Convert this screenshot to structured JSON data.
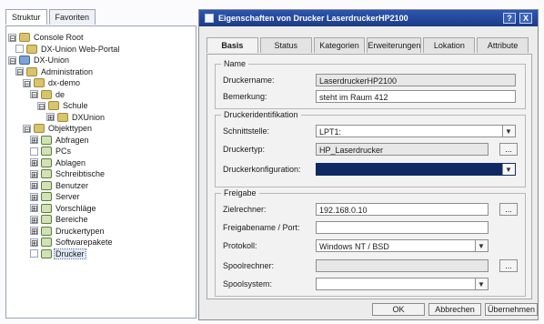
{
  "left": {
    "tabs": [
      "Struktur",
      "Favoriten"
    ],
    "tree": [
      {
        "label": "Console Root",
        "expander": "⊟",
        "icon": "folder-icon"
      },
      {
        "label": "DX-Union Web-Portal",
        "expander": "",
        "icon": "folder-icon"
      },
      {
        "label": "DX-Union",
        "expander": "⊟",
        "icon": "root-icon"
      },
      {
        "label": "Administration",
        "expander": "⊟",
        "icon": "folder-icon"
      },
      {
        "label": "dx-demo",
        "expander": "⊟",
        "icon": "folder-icon"
      },
      {
        "label": "de",
        "expander": "⊟",
        "icon": "folder-icon"
      },
      {
        "label": "Schule",
        "expander": "⊟",
        "icon": "folder-icon"
      },
      {
        "label": "DXUnion",
        "expander": "⊞",
        "icon": "folder-icon"
      },
      {
        "label": "Objekttypen",
        "expander": "⊟",
        "icon": "folder-icon"
      },
      {
        "label": "Abfragen",
        "expander": "⊞",
        "icon": "object-icon"
      },
      {
        "label": "PCs",
        "expander": "",
        "icon": "object-icon"
      },
      {
        "label": "Ablagen",
        "expander": "⊞",
        "icon": "object-icon"
      },
      {
        "label": "Schreibtische",
        "expander": "⊞",
        "icon": "object-icon"
      },
      {
        "label": "Benutzer",
        "expander": "⊞",
        "icon": "object-icon"
      },
      {
        "label": "Server",
        "expander": "⊞",
        "icon": "object-icon"
      },
      {
        "label": "Vorschläge",
        "expander": "⊞",
        "icon": "object-icon"
      },
      {
        "label": "Bereiche",
        "expander": "⊞",
        "icon": "object-icon"
      },
      {
        "label": "Druckertypen",
        "expander": "⊞",
        "icon": "object-icon"
      },
      {
        "label": "Softwarepakete",
        "expander": "⊞",
        "icon": "object-icon"
      },
      {
        "label": "Drucker",
        "expander": "",
        "icon": "object-icon",
        "selected": true
      }
    ]
  },
  "dialog": {
    "title": "Eigenschaften von Drucker LaserdruckerHP2100",
    "title_buttons": [
      "?",
      "X"
    ],
    "tabs": [
      "Basis",
      "Status",
      "Kategorien",
      "Erweiterungen",
      "Lokation",
      "Attribute"
    ],
    "active_tab": "Basis",
    "groups": {
      "name": "Name",
      "ident": "Druckeridentifikation",
      "share": "Freigabe"
    },
    "fields": {
      "printer_name_label": "Druckername:",
      "printer_name_value": "LaserdruckerHP2100",
      "remark_label": "Bemerkung:",
      "remark_value": "steht im Raum 412",
      "interface_label": "Schnittstelle:",
      "interface_value": "LPT1:",
      "printer_type_label": "Druckertyp:",
      "printer_type_value": "HP_Laserdrucker",
      "printer_config_label": "Druckerkonfiguration:",
      "printer_config_value": "",
      "target_computer_label": "Zielrechner:",
      "target_computer_value": "192.168.0.10",
      "share_port_label": "Freigabename / Port:",
      "share_port_value": "",
      "protocol_label": "Protokoll:",
      "protocol_value": "Windows NT / BSD",
      "spool_computer_label": "Spoolrechner:",
      "spool_computer_value": "",
      "spool_system_label": "Spoolsystem:",
      "spool_system_value": ""
    },
    "buttons": {
      "ok": "OK",
      "cancel": "Abbrechen",
      "apply": "Übernehmen"
    },
    "ellipsis": "..."
  }
}
